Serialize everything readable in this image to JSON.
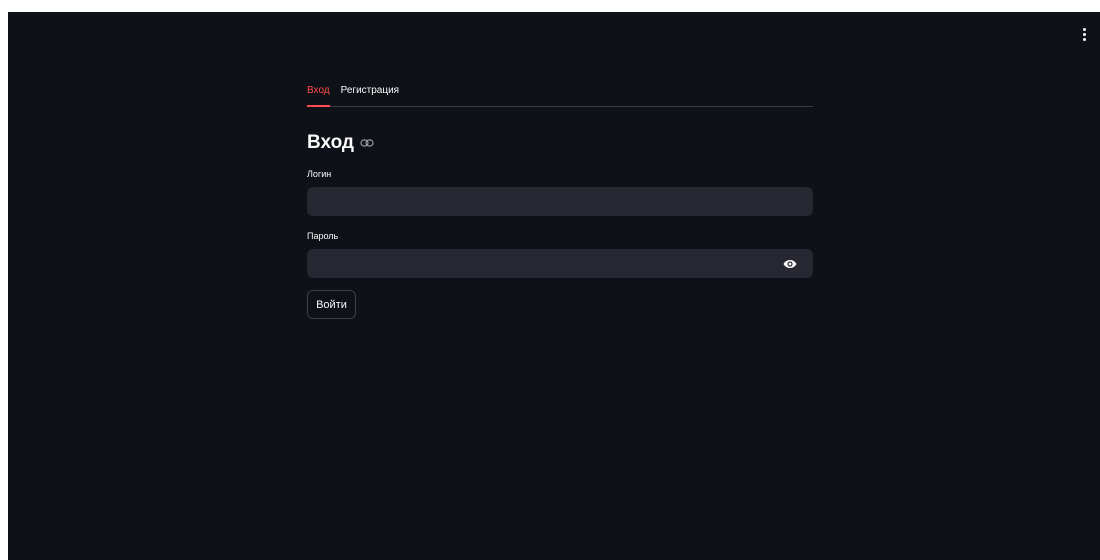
{
  "tabs": [
    {
      "label": "Вход",
      "active": true
    },
    {
      "label": "Регистрация",
      "active": false
    }
  ],
  "form": {
    "title": "Вход",
    "login_label": "Логин",
    "login_value": "",
    "password_label": "Пароль",
    "password_value": "",
    "submit_label": "Войти"
  },
  "icons": {
    "menu": "vertical-dots-icon",
    "anchor": "link-icon",
    "password_toggle": "eye-icon"
  },
  "colors": {
    "background": "#0e1117",
    "input_background": "#262730",
    "accent": "#ff4b4b",
    "text": "#fafafa"
  }
}
